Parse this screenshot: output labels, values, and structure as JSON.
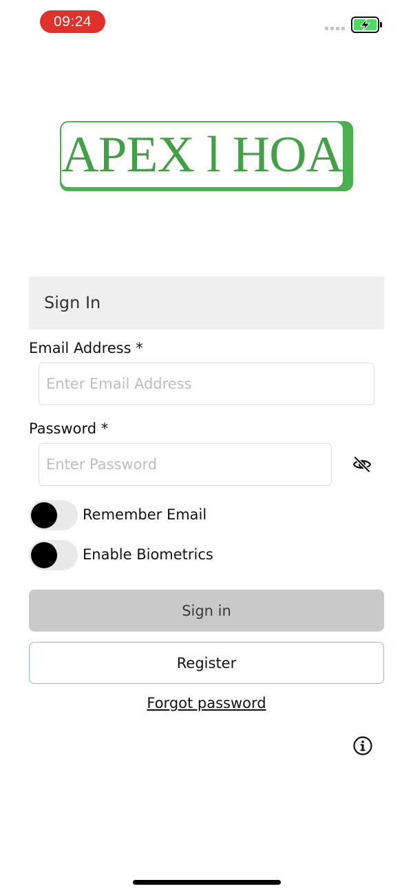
{
  "status_bar": {
    "time": "09:24",
    "time_pill_color": "#e0322b",
    "battery_icon": "battery-charging-icon",
    "battery_color": "#4cd964"
  },
  "logo": {
    "text": "APEX l HOA",
    "color": "#43a047"
  },
  "form": {
    "header": "Sign In",
    "email": {
      "label": "Email Address *",
      "placeholder": "Enter Email Address",
      "value": ""
    },
    "password": {
      "label": "Password *",
      "placeholder": "Enter Password",
      "value": "",
      "visibility_icon": "eye-slash-icon"
    },
    "toggles": [
      {
        "label": "Remember Email",
        "on": false
      },
      {
        "label": "Enable Biometrics",
        "on": false
      }
    ],
    "signin_label": "Sign in",
    "register_label": "Register",
    "forgot_label": "Forgot password",
    "info_icon": "info-circle-icon"
  }
}
